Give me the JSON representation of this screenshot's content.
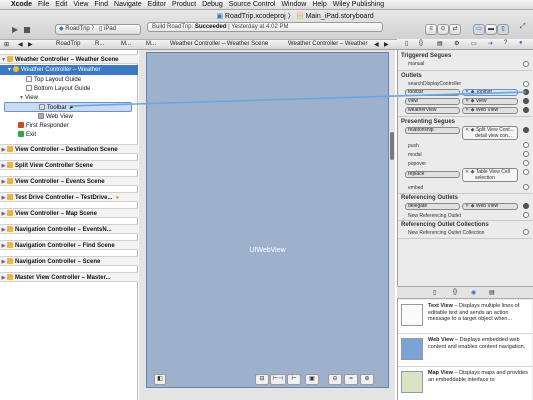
{
  "menubar": {
    "app": "Xcode",
    "items": [
      "File",
      "Edit",
      "View",
      "Find",
      "Navigate",
      "Editor",
      "Product",
      "Debug",
      "Source Control",
      "Window",
      "Help",
      "Wiley Publishing"
    ]
  },
  "window": {
    "title_project": "RoadTrip.xcodeproj",
    "title_file": "Main_iPad.storyboard",
    "scheme": "RoadTrip",
    "device": "iPad",
    "status_prefix": "Build RoadTrip:",
    "status_result": "Succeeded",
    "status_time": "Yesterday at 4:02 PM"
  },
  "jumpbar": {
    "crumbs": [
      "RoadTrip",
      "R...",
      "M...",
      "M...",
      "Weather Controller – Weather Scene",
      "Weather Controller – Weather"
    ]
  },
  "outline": {
    "rows": [
      {
        "label": "Weather Controller – Weather Scene",
        "type": "scene"
      },
      {
        "label": "Weather Controller – Weather",
        "type": "selected"
      },
      {
        "label": "Top Layout Guide",
        "type": "item"
      },
      {
        "label": "Bottom Layout Guide",
        "type": "item"
      },
      {
        "label": "View",
        "type": "item"
      },
      {
        "label": "Toolbar",
        "type": "item"
      },
      {
        "label": "Web View",
        "type": "item"
      },
      {
        "label": "First Responder",
        "type": "item"
      },
      {
        "label": "Exit",
        "type": "item"
      },
      {
        "label": "View Controller – Destination Scene",
        "type": "scene"
      },
      {
        "label": "Split View Controller Scene",
        "type": "scene"
      },
      {
        "label": "View Controller – Events Scene",
        "type": "scene"
      },
      {
        "label": "Test Drive Controller – TestDrive...",
        "type": "scene"
      },
      {
        "label": "View Controller – Map Scene",
        "type": "scene"
      },
      {
        "label": "Navigation Controller – EventsN...",
        "type": "scene"
      },
      {
        "label": "Navigation Controller – Find Scene",
        "type": "scene"
      },
      {
        "label": "Navigation Controller – Scene",
        "type": "scene"
      },
      {
        "label": "Master View Controller – Master...",
        "type": "scene"
      }
    ]
  },
  "canvas": {
    "view_label": "UIWebView"
  },
  "connections": {
    "triggered_segues_title": "Triggered Segues",
    "manual": "manual",
    "outlets_title": "Outlets",
    "search": "searchDisplayController",
    "toolbar": "toolbar",
    "toolbar_target": "Toolbar",
    "view": "view",
    "view_target": "View",
    "weatherView": "weatherView",
    "weatherView_target": "Web View",
    "presenting_title": "Presenting Segues",
    "relationship": "relationship",
    "relationship_target": "Split View Cont...",
    "relationship_sub": "detail view con...",
    "push": "push",
    "modal": "modal",
    "popover": "popover",
    "custom": "custom",
    "replace": "replace",
    "replace_target": "Table View Cell",
    "replace_sub": "selection",
    "embed": "embed",
    "referencing_title": "Referencing Outlets",
    "delegate": "delegate",
    "delegate_target": "Web View",
    "new_ref": "New Referencing Outlet",
    "ref_collections_title": "Referencing Outlet Collections",
    "new_ref_collection": "New Referencing Outlet Collection"
  },
  "library": {
    "items": [
      {
        "name": "Text View",
        "desc": "– Displays multiple lines of editable text and sends an action message to a target object when..."
      },
      {
        "name": "Web View",
        "desc": "– Displays embedded web content and enables content navigation."
      },
      {
        "name": "Map View",
        "desc": "– Displays maps and provides an embeddable interface to"
      }
    ]
  }
}
